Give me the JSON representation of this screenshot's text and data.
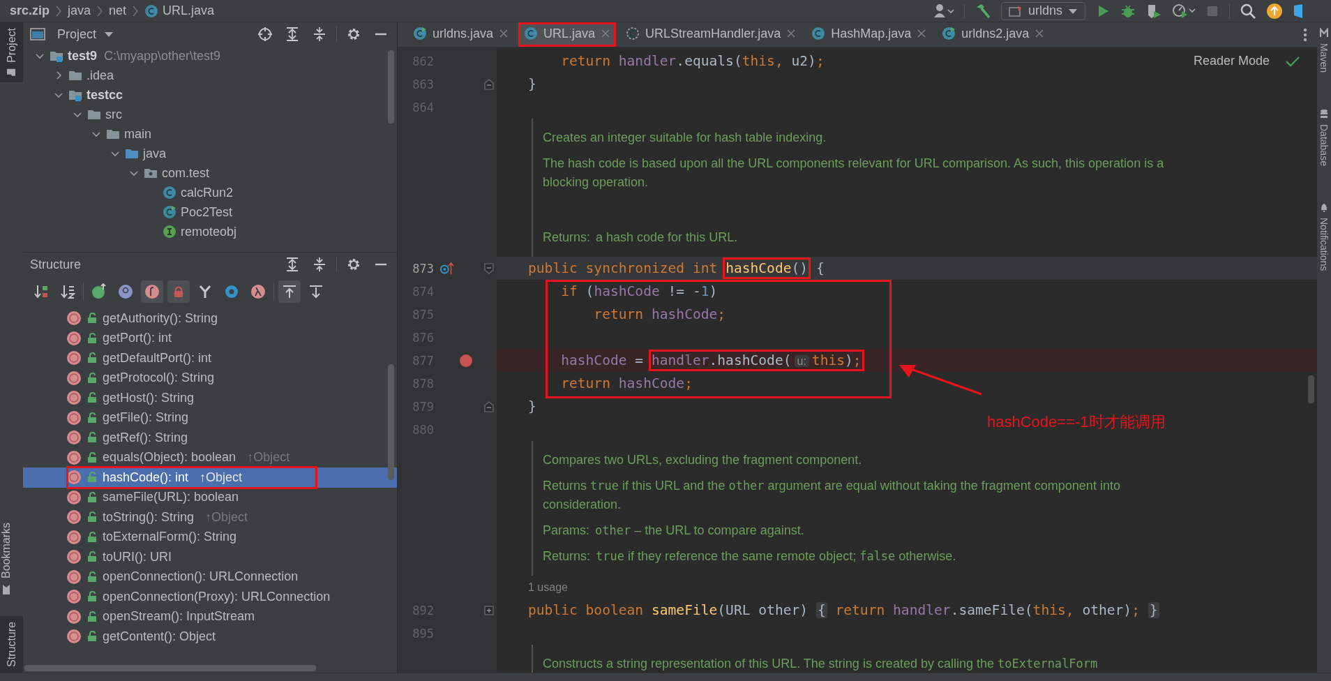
{
  "breadcrumb": [
    {
      "text": "src.zip",
      "kind": "archive"
    },
    {
      "text": "java",
      "kind": "folder"
    },
    {
      "text": "net",
      "kind": "folder"
    },
    {
      "text": "URL.java",
      "kind": "class"
    }
  ],
  "toolbar": {
    "run_config": "urldns"
  },
  "left_stripe": [
    {
      "label": "Project",
      "selected": true
    },
    {
      "label": "Bookmarks",
      "selected": false
    },
    {
      "label": "Structure",
      "selected": true
    }
  ],
  "right_stripe": [
    {
      "label": "Maven"
    },
    {
      "label": "Database"
    },
    {
      "label": "Notifications"
    }
  ],
  "project": {
    "title": "Project",
    "tree": [
      {
        "name": "test9",
        "path": "C:\\myapp\\other\\test9",
        "kind": "module",
        "expanded": true,
        "children": [
          {
            "name": ".idea",
            "kind": "folder",
            "expanded": false
          },
          {
            "name": "testcc",
            "kind": "module",
            "expanded": true,
            "children": [
              {
                "name": "src",
                "kind": "folder",
                "expanded": true,
                "children": [
                  {
                    "name": "main",
                    "kind": "folder",
                    "expanded": true,
                    "children": [
                      {
                        "name": "java",
                        "kind": "source",
                        "expanded": true,
                        "children": [
                          {
                            "name": "com.test",
                            "kind": "package",
                            "expanded": true,
                            "children": [
                              {
                                "name": "calcRun2",
                                "kind": "class"
                              },
                              {
                                "name": "Poc2Test",
                                "kind": "runnable"
                              },
                              {
                                "name": "remoteobj",
                                "kind": "interface"
                              }
                            ]
                          }
                        ]
                      }
                    ]
                  }
                ]
              }
            ]
          }
        ]
      }
    ]
  },
  "structure": {
    "title": "Structure",
    "filters": [
      {
        "kind": "sort-visibility",
        "on": false
      },
      {
        "kind": "sort-alpha",
        "on": false
      },
      {
        "kind": "inherited",
        "on": false
      },
      {
        "kind": "properties",
        "on": false
      },
      {
        "kind": "fields",
        "on": true
      },
      {
        "kind": "non-public",
        "on": true
      },
      {
        "kind": "anonymous",
        "on": false
      },
      {
        "kind": "circle",
        "on": false
      },
      {
        "kind": "lambdas",
        "on": false
      },
      {
        "kind": "scroll-to",
        "on": true
      },
      {
        "kind": "scroll-from",
        "on": false
      }
    ],
    "items": [
      {
        "text": "getAuthority(): String",
        "selected": false,
        "boxed": false
      },
      {
        "text": "getPort(): int",
        "selected": false,
        "boxed": false
      },
      {
        "text": "getDefaultPort(): int",
        "selected": false,
        "boxed": false
      },
      {
        "text": "getProtocol(): String",
        "selected": false,
        "boxed": false
      },
      {
        "text": "getHost(): String",
        "selected": false,
        "boxed": false
      },
      {
        "text": "getFile(): String",
        "selected": false,
        "boxed": false
      },
      {
        "text": "getRef(): String",
        "selected": false,
        "boxed": false
      },
      {
        "text": "equals(Object): boolean",
        "inherited": "↑Object",
        "selected": false,
        "boxed": false
      },
      {
        "text": "hashCode(): int",
        "inherited": "↑Object",
        "selected": true,
        "boxed": true
      },
      {
        "text": "sameFile(URL): boolean",
        "selected": false,
        "boxed": false
      },
      {
        "text": "toString(): String",
        "inherited": "↑Object",
        "selected": false,
        "boxed": false
      },
      {
        "text": "toExternalForm(): String",
        "selected": false,
        "boxed": false
      },
      {
        "text": "toURI(): URI",
        "selected": false,
        "boxed": false
      },
      {
        "text": "openConnection(): URLConnection",
        "selected": false,
        "boxed": false
      },
      {
        "text": "openConnection(Proxy): URLConnection",
        "selected": false,
        "boxed": false
      },
      {
        "text": "openStream(): InputStream",
        "selected": false,
        "boxed": false
      },
      {
        "text": "getContent(): Object",
        "selected": false,
        "boxed": false
      }
    ]
  },
  "tabs": [
    {
      "label": "urldns.java",
      "kind": "runnable",
      "selected": false,
      "boxed": false
    },
    {
      "label": "URL.java",
      "kind": "class",
      "selected": true,
      "boxed": true
    },
    {
      "label": "URLStreamHandler.java",
      "kind": "abstract",
      "selected": false,
      "boxed": false
    },
    {
      "label": "HashMap.java",
      "kind": "class",
      "selected": false,
      "boxed": false
    },
    {
      "label": "urldns2.java",
      "kind": "runnable",
      "selected": false,
      "boxed": false
    }
  ],
  "editor": {
    "reader_mode": "Reader Mode",
    "callout": "hashCode==-1时才能调用",
    "lines": [
      {
        "kind": "code",
        "number": "862",
        "tokens": [
          {
            "kind": "keyword",
            "text": "    return "
          },
          {
            "kind": "field",
            "text": "handler"
          },
          {
            "kind": "plain",
            "text": ".equals("
          },
          {
            "kind": "keyword",
            "text": "this, "
          },
          {
            "kind": "plain",
            "text": "u2)"
          },
          {
            "kind": "keyword",
            "text": ";"
          }
        ]
      },
      {
        "kind": "code",
        "number": "863",
        "fold": {
          "kind": "end"
        },
        "tokens": [
          {
            "kind": "plain",
            "text": "}"
          }
        ]
      },
      {
        "kind": "code",
        "number": "864"
      },
      {
        "kind": "doc",
        "paragraphs": [
          {
            "kind": "text",
            "parts": [
              {
                "kind": "text",
                "text": "Creates an integer suitable for hash table indexing."
              }
            ]
          },
          {
            "kind": "text",
            "parts": [
              {
                "kind": "text",
                "text": "The hash code is based upon all the URL components relevant for URL comparison. As such, this operation is a blocking operation."
              }
            ]
          },
          {
            "kind": "tag",
            "label": "Returns:",
            "parts": [
              {
                "kind": "text",
                "text": "a hash code for this URL."
              }
            ]
          }
        ]
      },
      {
        "kind": "code",
        "number": "873",
        "overrides": true,
        "current": true,
        "fold": {
          "kind": "start"
        },
        "tokens": [
          {
            "kind": "keyword",
            "text": "public synchronized int "
          },
          {
            "kind": "group",
            "boxed": true,
            "tokens": [
              {
                "kind": "method",
                "text": "hashCode"
              },
              {
                "kind": "plain",
                "text": "()"
              }
            ]
          },
          {
            "kind": "plain",
            "text": " {"
          }
        ]
      },
      {
        "kind": "group",
        "boxed": true,
        "lines": [
          {
            "kind": "code",
            "number": "874",
            "tokens": [
              {
                "kind": "keyword",
                "text": "    if "
              },
              {
                "kind": "plain",
                "text": "("
              },
              {
                "kind": "field",
                "text": "hashCode"
              },
              {
                "kind": "plain",
                "text": " != -"
              },
              {
                "kind": "number",
                "text": "1"
              },
              {
                "kind": "plain",
                "text": ")"
              }
            ]
          },
          {
            "kind": "code",
            "number": "875",
            "tokens": [
              {
                "kind": "keyword",
                "text": "        return "
              },
              {
                "kind": "field",
                "text": "hashCode"
              },
              {
                "kind": "keyword",
                "text": ";"
              }
            ]
          },
          {
            "kind": "code",
            "number": "876"
          },
          {
            "kind": "code",
            "number": "877",
            "breakpoint": true,
            "tokens": [
              {
                "kind": "field",
                "text": "    hashCode"
              },
              {
                "kind": "plain",
                "text": " = "
              },
              {
                "kind": "group",
                "boxed": true,
                "tokens": [
                  {
                    "kind": "field",
                    "text": "handler"
                  },
                  {
                    "kind": "plain",
                    "text": ".hashCode("
                  },
                  {
                    "kind": "hint",
                    "text": "u:"
                  },
                  {
                    "kind": "keyword",
                    "text": "this"
                  },
                  {
                    "kind": "plain",
                    "text": ")"
                  },
                  {
                    "kind": "keyword",
                    "text": ";"
                  }
                ]
              }
            ]
          },
          {
            "kind": "code",
            "number": "878",
            "tokens": [
              {
                "kind": "keyword",
                "text": "    return "
              },
              {
                "kind": "field",
                "text": "hashCode"
              },
              {
                "kind": "keyword",
                "text": ";"
              }
            ]
          }
        ]
      },
      {
        "kind": "code",
        "number": "879",
        "fold": {
          "kind": "end"
        },
        "tokens": [
          {
            "kind": "plain",
            "text": "}"
          }
        ]
      },
      {
        "kind": "code",
        "number": "880"
      },
      {
        "kind": "doc",
        "paragraphs": [
          {
            "kind": "text",
            "parts": [
              {
                "kind": "text",
                "text": "Compares two URLs, excluding the fragment component."
              }
            ]
          },
          {
            "kind": "text",
            "parts": [
              {
                "kind": "text",
                "text": "Returns "
              },
              {
                "kind": "code",
                "text": "true"
              },
              {
                "kind": "text",
                "text": " if this URL and the "
              },
              {
                "kind": "code",
                "text": "other"
              },
              {
                "kind": "text",
                "text": " argument are equal without taking the fragment component into consideration."
              }
            ]
          },
          {
            "kind": "tag",
            "label": "Params:",
            "parts": [
              {
                "kind": "code",
                "text": "other"
              },
              {
                "kind": "text",
                "text": " – the URL to compare against."
              }
            ]
          },
          {
            "kind": "tag",
            "label": "Returns:",
            "parts": [
              {
                "kind": "code",
                "text": "true"
              },
              {
                "kind": "text",
                "text": " if they reference the same remote object; "
              },
              {
                "kind": "code",
                "text": "false"
              },
              {
                "kind": "text",
                "text": " otherwise."
              }
            ]
          }
        ]
      },
      {
        "kind": "usage",
        "text": "1 usage"
      },
      {
        "kind": "code",
        "number": "892",
        "fold": {
          "kind": "collapsed"
        },
        "tokens": [
          {
            "kind": "keyword",
            "text": "public boolean "
          },
          {
            "kind": "method",
            "text": "sameFile"
          },
          {
            "kind": "plain",
            "text": "(URL other) "
          },
          {
            "kind": "fold",
            "text": "{"
          },
          {
            "kind": "keyword",
            "text": " return "
          },
          {
            "kind": "field",
            "text": "handler"
          },
          {
            "kind": "plain",
            "text": ".sameFile("
          },
          {
            "kind": "keyword",
            "text": "this, "
          },
          {
            "kind": "plain",
            "text": "other)"
          },
          {
            "kind": "keyword",
            "text": "; "
          },
          {
            "kind": "fold",
            "text": "}"
          }
        ]
      },
      {
        "kind": "code",
        "number": "895"
      },
      {
        "kind": "doc",
        "paragraphs": [
          {
            "kind": "text",
            "parts": [
              {
                "kind": "text",
                "text": "Constructs a string representation of this URL. The string is created by calling the "
              },
              {
                "kind": "code",
                "text": "toExternalForm"
              }
            ]
          }
        ]
      }
    ]
  }
}
